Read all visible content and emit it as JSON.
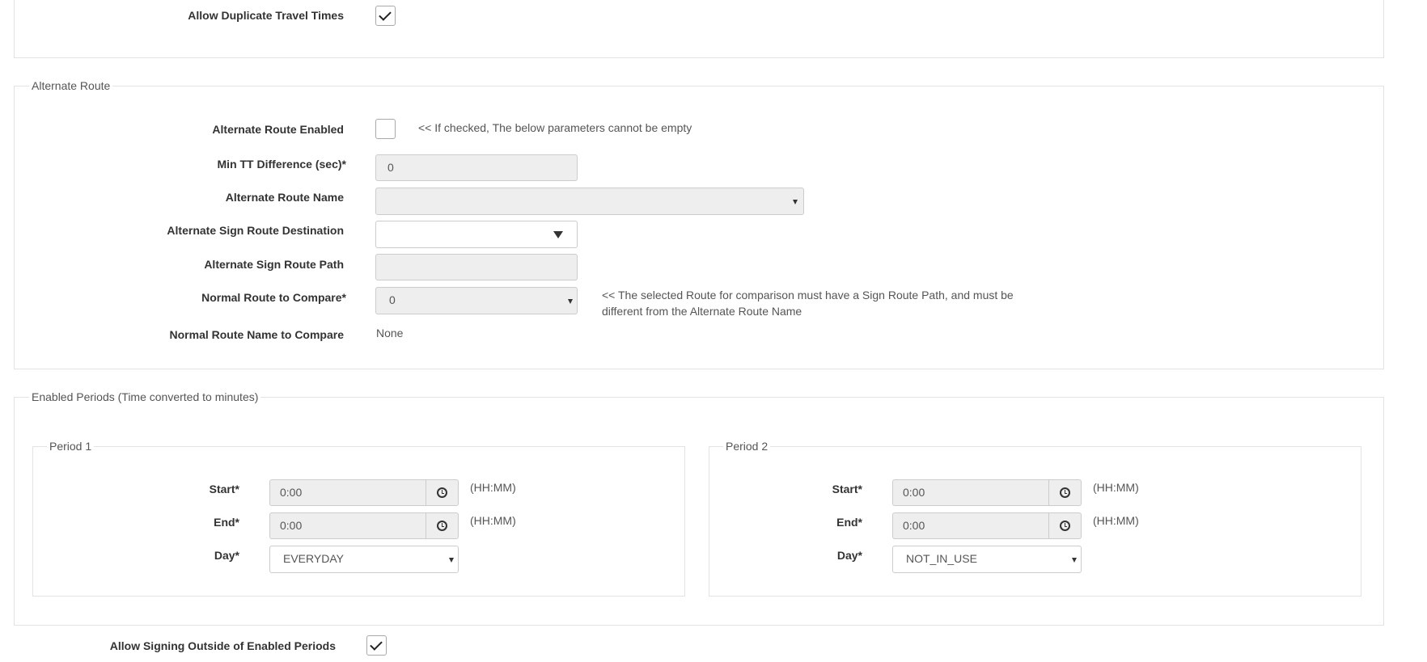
{
  "top": {
    "allow_duplicate_label": "Allow Duplicate Travel Times",
    "allow_duplicate_checked": true
  },
  "alternate_route": {
    "legend": "Alternate Route",
    "enabled_label": "Alternate Route Enabled",
    "enabled_checked": false,
    "enabled_note": "<< If checked, The below parameters cannot be empty",
    "min_tt_label": "Min TT Difference (sec)*",
    "min_tt_value": "0",
    "route_name_label": "Alternate Route Name",
    "route_name_value": "",
    "sign_dest_label": "Alternate Sign Route Destination",
    "sign_dest_value": "",
    "sign_path_label": "Alternate Sign Route Path",
    "sign_path_value": "",
    "normal_compare_label": "Normal Route to Compare*",
    "normal_compare_value": "0",
    "normal_compare_note_line1": "<< The selected Route for comparison must have a Sign Route Path, and must be",
    "normal_compare_note_line2": "different from the Alternate Route Name",
    "normal_name_label": "Normal Route Name to Compare",
    "normal_name_value": "None"
  },
  "periods": {
    "legend": "Enabled Periods (Time converted to minutes)",
    "period1": {
      "legend": "Period 1",
      "start_label": "Start*",
      "start_value": "0:00",
      "start_hint": "(HH:MM)",
      "end_label": "End*",
      "end_value": "0:00",
      "end_hint": "(HH:MM)",
      "day_label": "Day*",
      "day_value": "EVERYDAY"
    },
    "period2": {
      "legend": "Period 2",
      "start_label": "Start*",
      "start_value": "0:00",
      "start_hint": "(HH:MM)",
      "end_label": "End*",
      "end_value": "0:00",
      "end_hint": "(HH:MM)",
      "day_label": "Day*",
      "day_value": "NOT_IN_USE"
    }
  },
  "bottom": {
    "allow_signing_label": "Allow Signing Outside of Enabled Periods",
    "allow_signing_checked": true
  },
  "icons": {
    "clock": "clock-icon",
    "checkmark": "checkmark-icon",
    "dropdown": "caret-down-icon"
  }
}
